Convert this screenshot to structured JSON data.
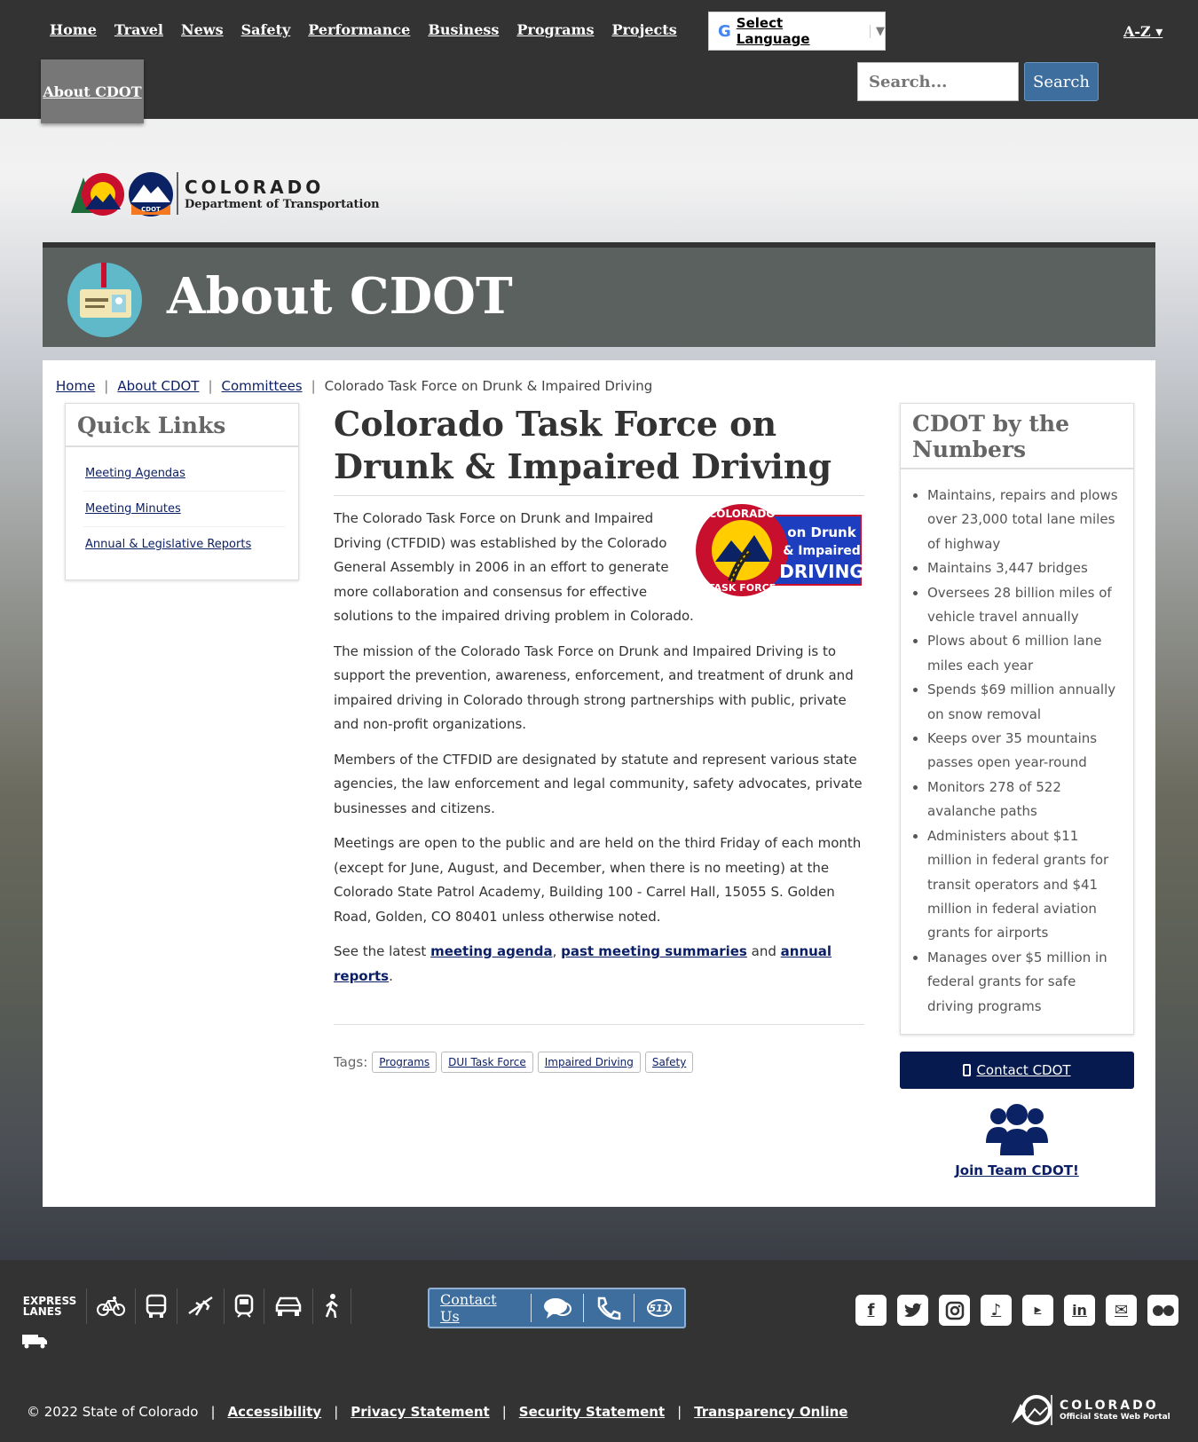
{
  "nav": {
    "items": [
      "Home",
      "Travel",
      "News",
      "Safety",
      "Performance",
      "Business",
      "Programs",
      "Projects"
    ],
    "active": "About CDOT",
    "az": "A-Z"
  },
  "language": {
    "label": "Select Language"
  },
  "search": {
    "placeholder": "Search...",
    "button": "Search"
  },
  "logo": {
    "line1": "COLORADO",
    "line2": "Department of Transportation",
    "badge": "CDOT"
  },
  "banner": {
    "title": "About CDOT"
  },
  "breadcrumb": [
    "Home",
    "About CDOT",
    "Committees",
    "Colorado Task Force on Drunk & Impaired Driving"
  ],
  "quick_links": {
    "title": "Quick Links",
    "items": [
      "Meeting Agendas",
      "Meeting Minutes",
      "Annual & Legislative Reports"
    ]
  },
  "article": {
    "title": "Colorado Task Force on Drunk & Impaired Driving",
    "logo_text": {
      "arc": "COLORADO",
      "arc2": "TASK FORCE",
      "l1": "on Drunk",
      "l2": "& Impaired",
      "l3": "DRIVING"
    },
    "p1": "The Colorado Task Force on Drunk and Impaired Driving (CTFDID) was established by the Colorado General Assembly in 2006 in an effort to generate more collaboration and consensus for effective solutions to the impaired driving problem in Colorado.",
    "p2": "The mission of the Colorado Task Force on Drunk and Impaired Driving is to support the prevention, awareness, enforcement, and treatment of drunk and impaired driving in Colorado through strong partnerships with public, private and non-profit organizations.",
    "p3": "Members of the CTFDID are designated by statute and represent various state agencies, the law enforcement and legal community, safety advocates, private businesses and citizens.",
    "p4": "Meetings are open to the public and are held on the third Friday of each month (except for June, August, and December, when there is no meeting) at the Colorado State Patrol Academy, Building 100 - Carrel Hall, 15055 S. Golden Road, Golden, CO  80401 unless otherwise noted.",
    "p5_prefix": "See the latest ",
    "p5_link1": "meeting agenda",
    "p5_sep1": ", ",
    "p5_link2": "past meeting summaries",
    "p5_sep2": " and ",
    "p5_link3": "annual reports",
    "p5_suffix": ".",
    "tags_label": "Tags:",
    "tags": [
      "Programs",
      "DUI Task Force",
      "Impaired Driving",
      "Safety"
    ]
  },
  "numbers": {
    "title": "CDOT by the Numbers",
    "items": [
      "Maintains, repairs and plows over 23,000 total lane miles of highway",
      "Maintains 3,447 bridges",
      "Oversees 28 billion miles of vehicle travel annually",
      "Plows about 6 million lane miles each year",
      "Spends $69 million annually on snow removal",
      "Keeps over 35 mountains passes open year-round",
      "Monitors 278 of 522 avalanche paths",
      "Administers about $11 million in federal grants for transit operators and $41 million in federal aviation grants for airports",
      "Manages over $5 million in federal grants for safe driving programs"
    ],
    "contact": "Contact CDOT",
    "join": "Join Team CDOT!"
  },
  "footer": {
    "express_lanes": "EXPRESS LANES",
    "contact_us": "Contact Us",
    "badge_511": "511",
    "copyright": "© 2022 State of Colorado",
    "links": [
      "Accessibility",
      "Privacy Statement",
      "Security Statement",
      "Transparency Online"
    ],
    "state_logo_line1": "COLORADO",
    "state_logo_line2": "Official State Web Portal"
  },
  "colors": {
    "nav_bg": "#333333",
    "banner_bg": "#5a615e",
    "link": "#0b1f66",
    "search_btn": "#3e6e9e",
    "contact_btn": "#061a4f"
  }
}
